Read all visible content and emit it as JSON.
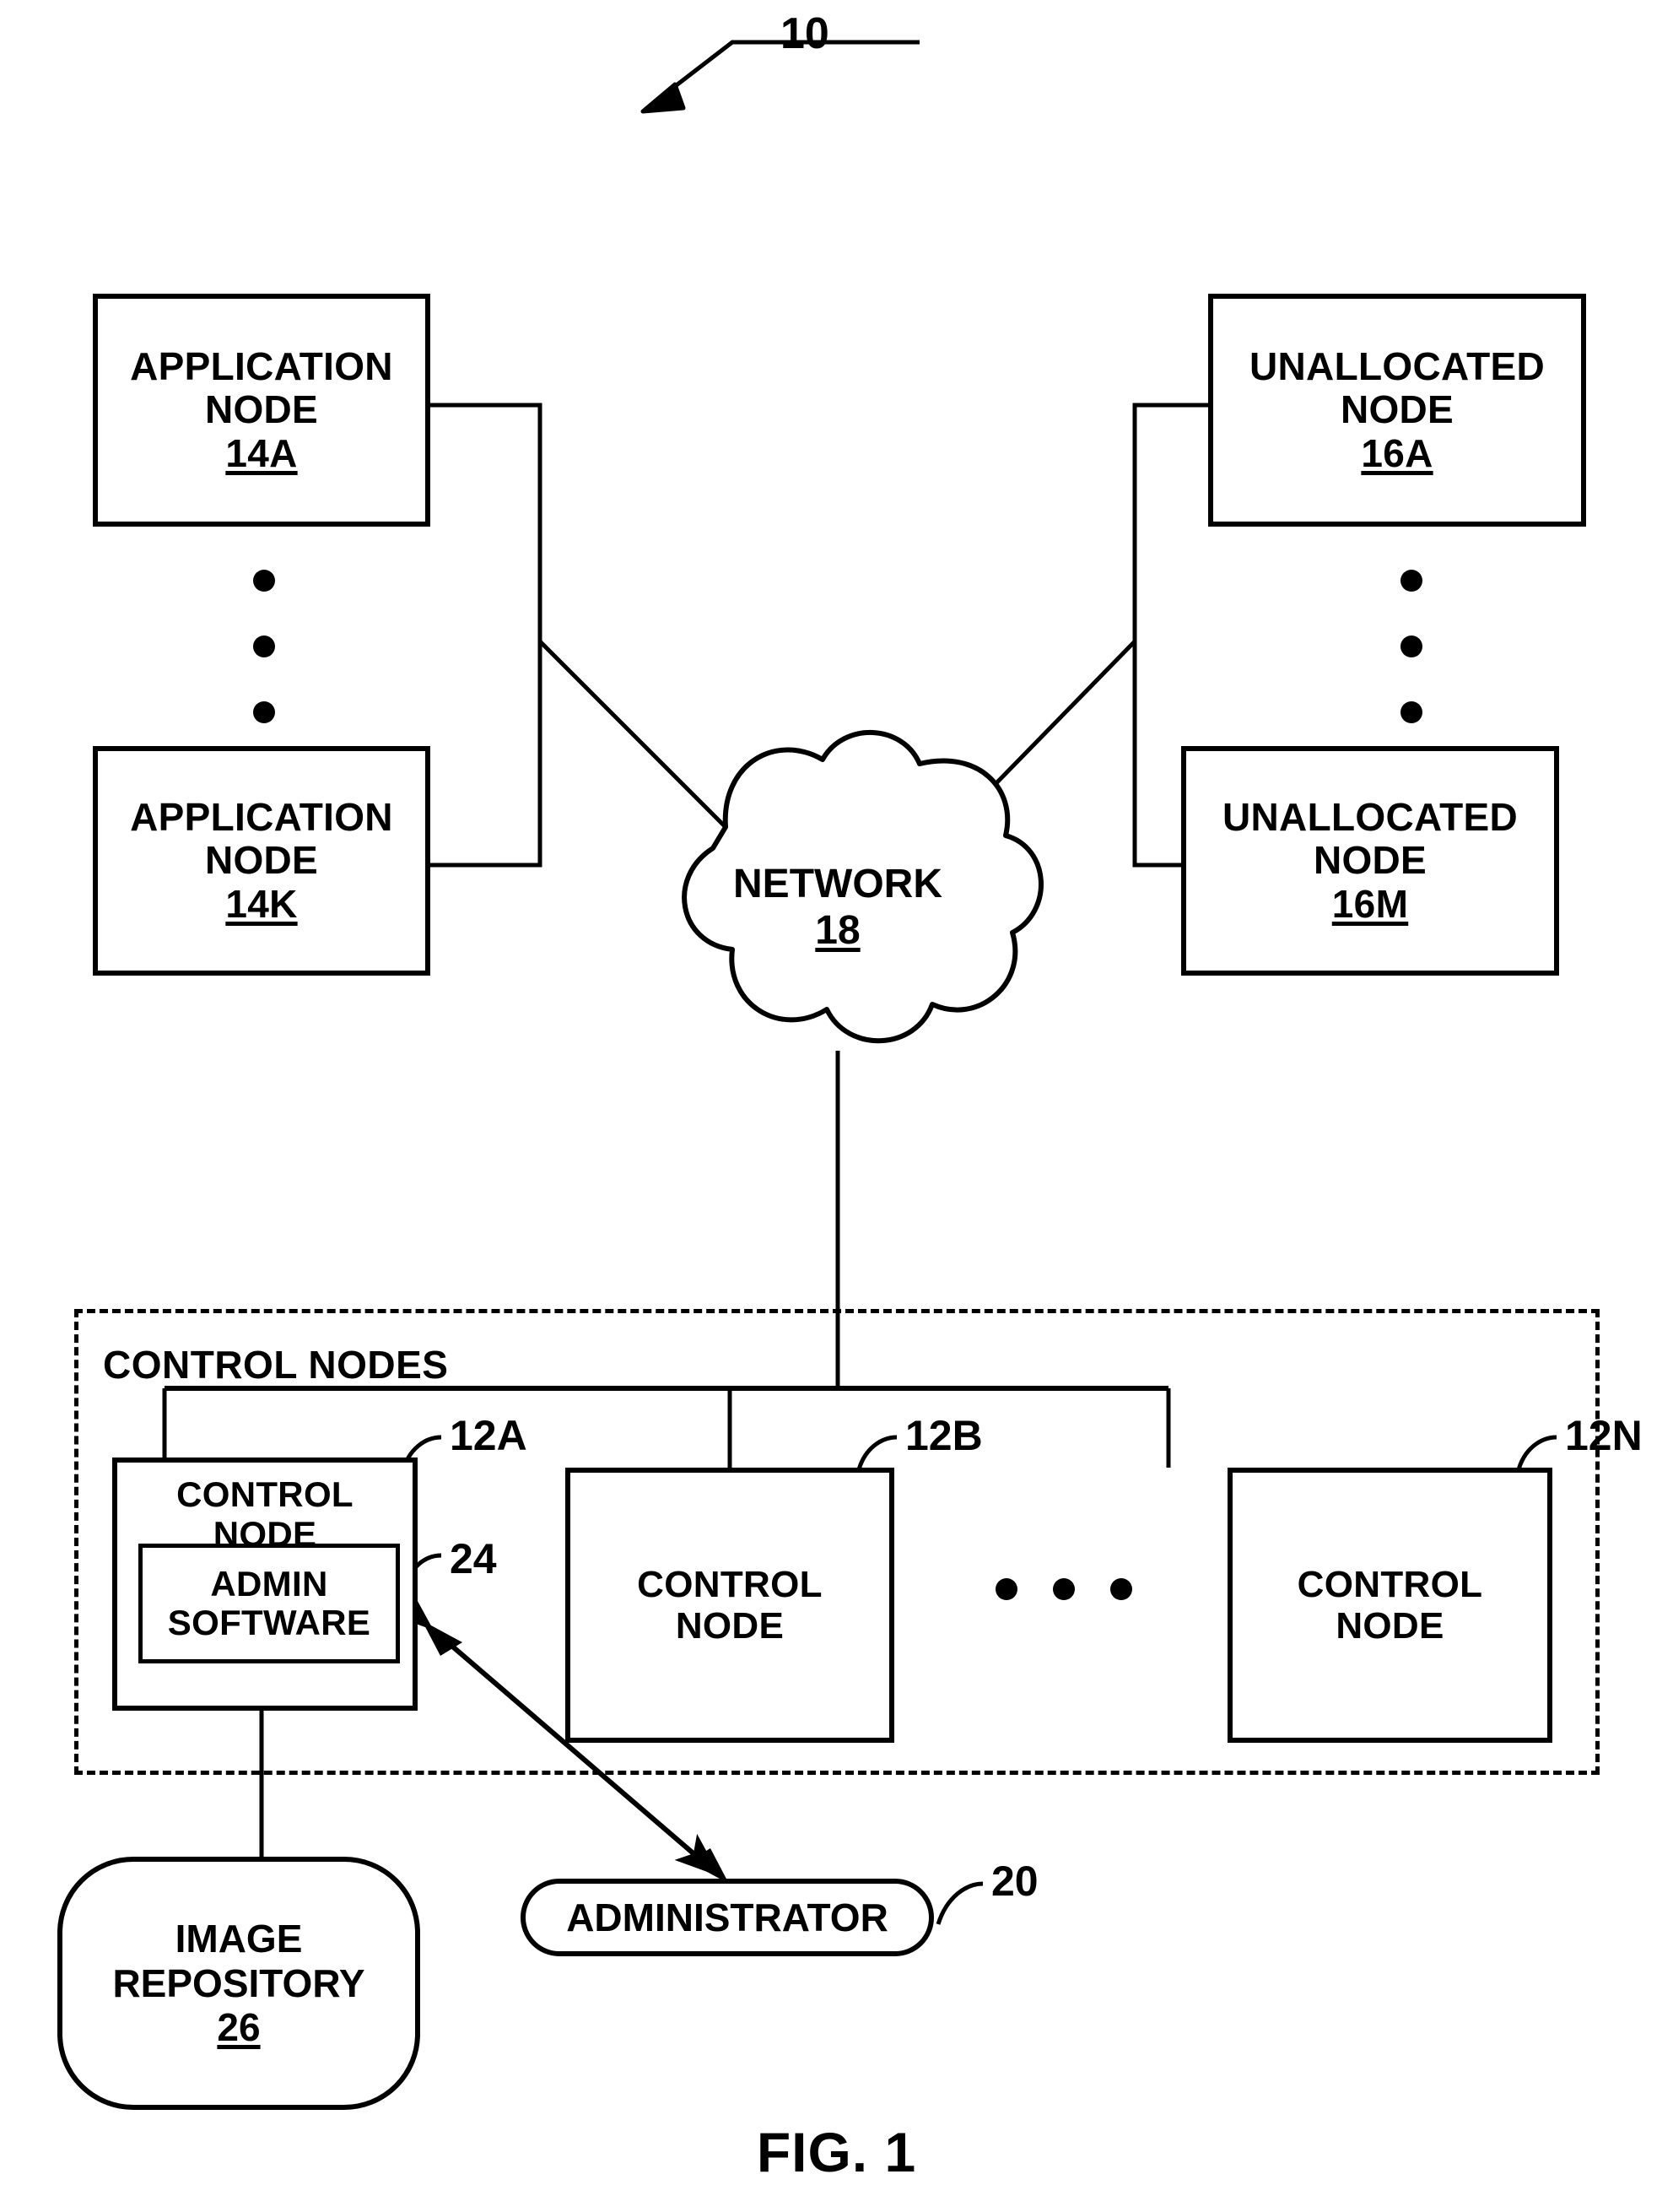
{
  "figure": {
    "caption": "FIG. 1",
    "system_ref": "10"
  },
  "application_nodes": [
    {
      "title_line1": "APPLICATION",
      "title_line2": "NODE",
      "ref": "14A"
    },
    {
      "title_line1": "APPLICATION",
      "title_line2": "NODE",
      "ref": "14K"
    }
  ],
  "unallocated_nodes": [
    {
      "title_line1": "UNALLOCATED",
      "title_line2": "NODE",
      "ref": "16A"
    },
    {
      "title_line1": "UNALLOCATED",
      "title_line2": "NODE",
      "ref": "16M"
    }
  ],
  "network": {
    "label": "NETWORK",
    "ref": "18"
  },
  "control_nodes_group": {
    "label": "CONTROL NODES",
    "nodes": [
      {
        "title_line1": "CONTROL",
        "title_line2": "NODE",
        "ref": "12A",
        "inner": {
          "title_line1": "ADMIN",
          "title_line2": "SOFTWARE",
          "ref": "24"
        }
      },
      {
        "title_line1": "CONTROL",
        "title_line2": "NODE",
        "ref": "12B"
      },
      {
        "title_line1": "CONTROL",
        "title_line2": "NODE",
        "ref": "12N"
      }
    ],
    "ellipsis": "• • •"
  },
  "image_repository": {
    "title_line1": "IMAGE",
    "title_line2": "REPOSITORY",
    "ref": "26"
  },
  "administrator": {
    "label": "ADMINISTRATOR",
    "ref": "20"
  },
  "colors": {
    "ink": "#000000",
    "paper": "#ffffff"
  }
}
